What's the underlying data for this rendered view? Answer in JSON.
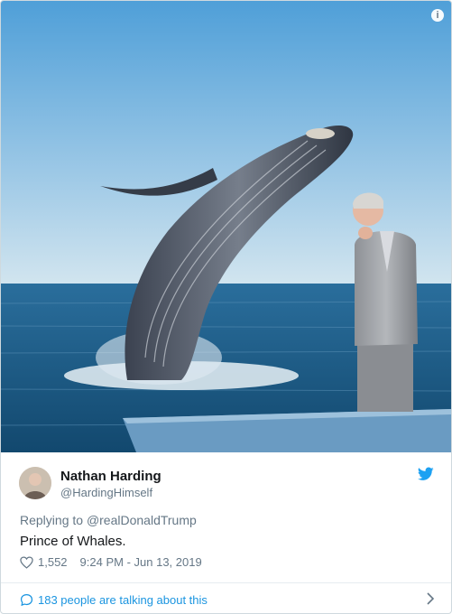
{
  "tweet": {
    "author_name": "Nathan Harding",
    "author_handle": "@HardingHimself",
    "reply_prefix": "Replying to",
    "reply_to": "@realDonaldTrump",
    "text": "Prince of Whales.",
    "like_count": "1,552",
    "timestamp": "9:24 PM - Jun 13, 2019",
    "conversation": "183 people are talking about this"
  },
  "media": {
    "description_icon": "info-icon",
    "subject_icons": [
      "whale-image",
      "man-in-suit-image"
    ]
  },
  "colors": {
    "accent": "#1b95e0",
    "sky_top": "#4f9fd8",
    "sky_bottom": "#cfe3ef",
    "sea": "#1f5f8f",
    "text_primary": "#14171a",
    "text_secondary": "#657786"
  }
}
